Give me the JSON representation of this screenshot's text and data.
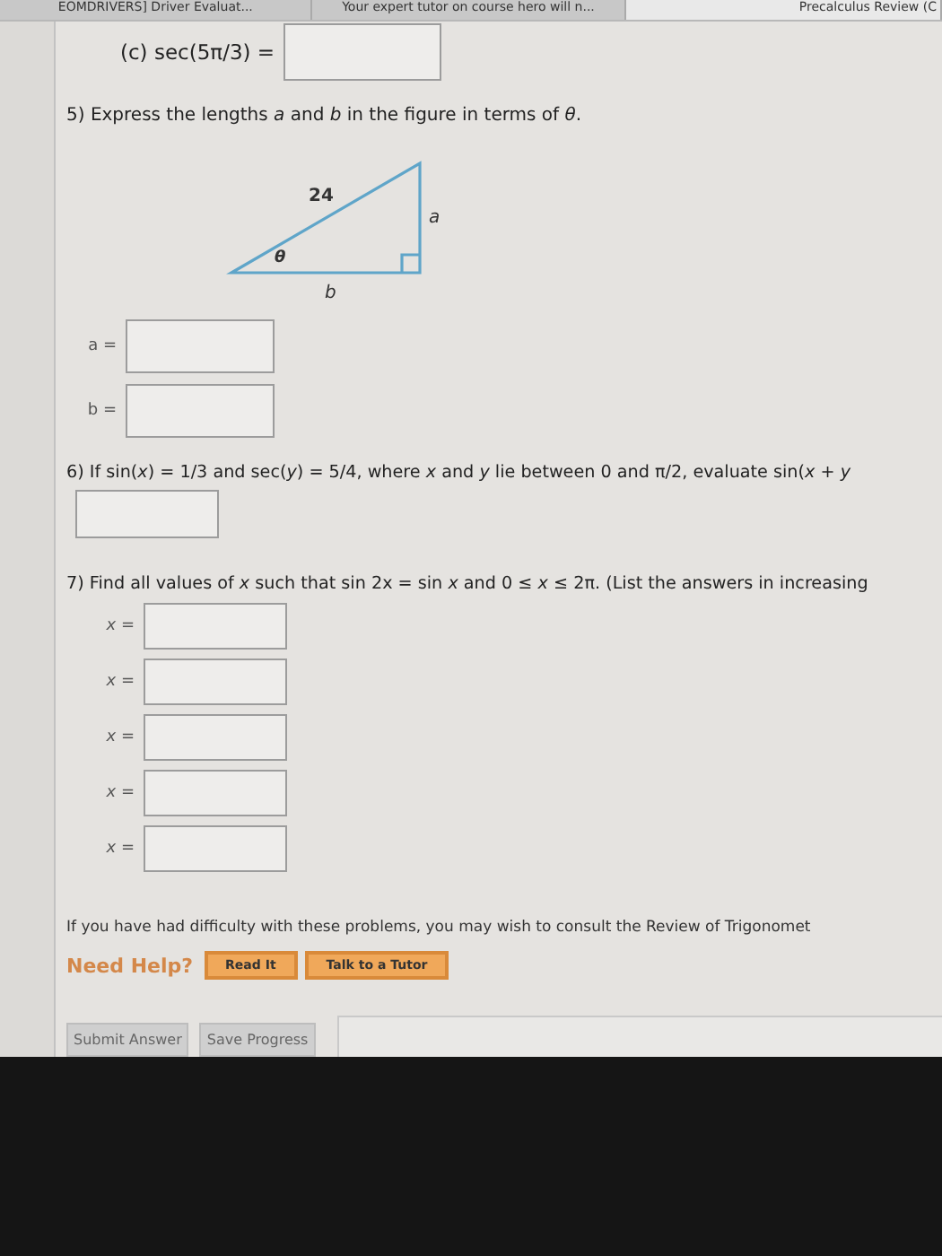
{
  "browser_tabs": [
    {
      "label": "EOMDRIVERS] Driver Evaluat...",
      "selected": false
    },
    {
      "label": "Your expert tutor on course hero will n...",
      "selected": false
    },
    {
      "label": "Precalculus Review (C",
      "selected": true
    }
  ],
  "part_c": {
    "label": "(c) sec(5π/3) ="
  },
  "question_5": {
    "text": "5) Express the lengths *a* and *b* in the figure in terms of *θ*.",
    "figure": {
      "hypotenuse": "24",
      "side_a": "a",
      "side_b": "b",
      "angle": "θ"
    },
    "answers": [
      {
        "label": "a ="
      },
      {
        "label": "b ="
      }
    ]
  },
  "question_6": {
    "text": "6) If sin(*x*) = 1/3 and sec(*y*) = 5/4, where *x* and *y* lie between 0 and π/2, evaluate sin(*x* + *y*"
  },
  "question_7": {
    "text": "7) Find all values of *x* such that sin 2x = sin *x* and 0 ≤ *x* ≤ 2π. (List the answers in increasing",
    "answers": [
      {
        "label": "x ="
      },
      {
        "label": "x ="
      },
      {
        "label": "x ="
      },
      {
        "label": "x ="
      },
      {
        "label": "x ="
      }
    ]
  },
  "help": {
    "text": "If you have had difficulty with these problems, you may wish to consult the Review of Trigonomet",
    "title": "Need Help?",
    "buttons": [
      "Read It",
      "Talk to a Tutor"
    ]
  },
  "actions": [
    "Submit Answer",
    "Save Progress"
  ]
}
